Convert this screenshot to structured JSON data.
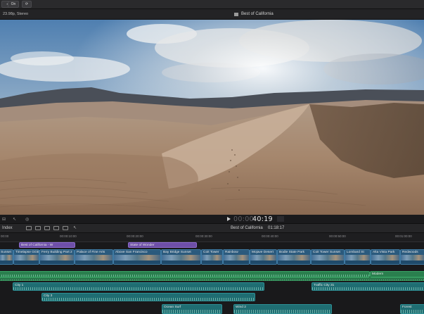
{
  "toolbar": {
    "buttons": [
      {
        "label": "✓"
      },
      {
        "label": "On"
      },
      {
        "label": "⟳"
      }
    ]
  },
  "viewer": {
    "format": "23.98p, Stereo",
    "title": "Best of California"
  },
  "playback": {
    "timecode_dim": "00:00",
    "timecode": "40:19",
    "left_controls": [
      "⊟",
      "↖",
      "◎"
    ]
  },
  "timeline_header": {
    "index_label": "Index",
    "project_name": "Best of California",
    "duration": "01:18:17"
  },
  "ruler": {
    "ticks": [
      "00:00",
      "00:00:10:00",
      "00:00:20:00",
      "00:00:30:00",
      "00:00:40:00",
      "00:00:50:00",
      "00:01:00:00"
    ]
  },
  "timeline": {
    "title_clips": [
      {
        "label": "Best of California - W"
      },
      {
        "label": "State of Wonder"
      }
    ],
    "video_clips": [
      {
        "label": "Sunset"
      },
      {
        "label": "Timelapse GGB"
      },
      {
        "label": "Ferry Building Part 2"
      },
      {
        "label": "Palace of Fine Arts"
      },
      {
        "label": "Above San Francisco"
      },
      {
        "label": "Bay Bridge Sunset"
      },
      {
        "label": "Coit Tower"
      },
      {
        "label": "Rainbow"
      },
      {
        "label": "Mojave Desert"
      },
      {
        "label": "Bodie State Park"
      },
      {
        "label": "Coit Tower Sunset"
      },
      {
        "label": "Lombard St"
      },
      {
        "label": "Alta Vista Park"
      },
      {
        "label": "Redwoods"
      }
    ],
    "audio_clips": [
      {
        "label": "Modern"
      }
    ],
    "teal_clips": [
      {
        "label": "City 1"
      },
      {
        "label": "City 3"
      },
      {
        "label": "Traffic City 31"
      },
      {
        "label": "Ocean Surf"
      },
      {
        "label": "Wind 2"
      },
      {
        "label": "Forest"
      }
    ]
  }
}
